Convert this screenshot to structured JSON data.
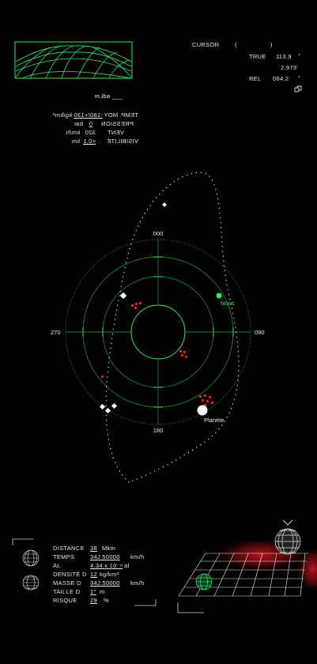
{
  "cursor": {
    "label": "CURSOR",
    "paren_open": "(",
    "paren_close": ")",
    "true_label": "TRUE",
    "true_value": "113.9",
    "unit1": "°",
    "secondary_value": "2.973'",
    "rel_label": "REL",
    "rel_value": "064.2",
    "unit2": "°"
  },
  "mirrored_conditions": {
    "header": "___ adLm",
    "rows": [
      {
        "label": "TEMP. MOY",
        "value": "-180/+130",
        "unit": "kg/km²"
      },
      {
        "label": "PRESSION",
        "value": "0",
        "unit": "bar"
      },
      {
        "label": "VENT",
        "value": "320",
        "unit": "km/h"
      },
      {
        "label": "VISIBILITÉ",
        "value": "<0.1",
        "unit": "km"
      }
    ]
  },
  "radar": {
    "bearing_top": "000",
    "bearing_right": "090",
    "bearing_bottom": "180",
    "bearing_left": "270",
    "us_label": "Nous",
    "planet_label": "Planète"
  },
  "stats": {
    "rows": [
      {
        "label": "DISTANCE",
        "value": "38",
        "unit": "Mkm"
      },
      {
        "label": "TEMPS",
        "value": "34J.50000",
        "unit": "km/h"
      },
      {
        "label": "AL",
        "value": "4.34 x 10⁻⁶",
        "unit": "al"
      },
      {
        "label": "DENSITÉ D",
        "value": "12",
        "unit": "kg/km³"
      },
      {
        "label": "MASSE D",
        "value": "34J.50000",
        "unit": "km/h"
      },
      {
        "label": "TAILLE D",
        "value": "1°",
        "unit": "m"
      },
      {
        "label": "RISQUE",
        "value": "29",
        "unit": "%"
      }
    ]
  },
  "colors": {
    "accent_green": "#2ee86a",
    "grid_green": "#1e7a3c",
    "hazard_red": "#e8281e",
    "text": "#e8e8e8"
  }
}
